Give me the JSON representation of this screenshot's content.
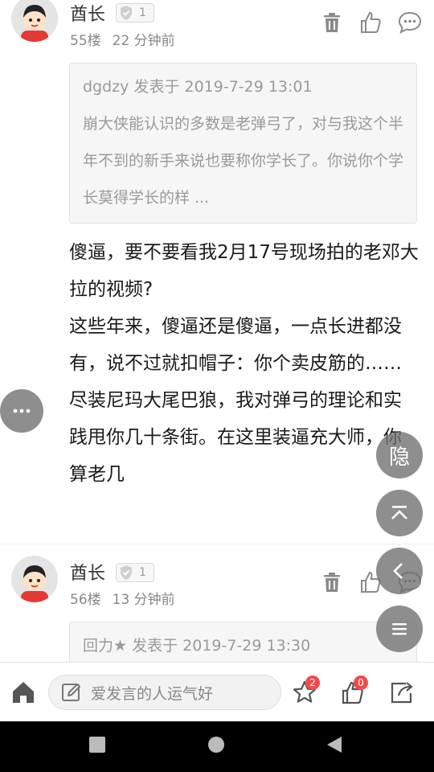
{
  "posts": [
    {
      "username": "酋长",
      "level": "1",
      "floor": "55楼",
      "time": "22 分钟前",
      "quote": {
        "header": "dgdzy 发表于 2019-7-29 13:01",
        "text": "崩大侠能认识的多数是老弹弓了，对与我这个半年不到的新手来说也要称你学长了。你说你个学长莫得学长的样 ..."
      },
      "content": [
        "傻逼，要不要看我2月17号现场拍的老邓大拉的视频?",
        "这些年来，傻逼还是傻逼，一点长进都没有，说不过就扣帽子：你个卖皮筋的……",
        "尽装尼玛大尾巴狼，我对弹弓的理论和实践甩你几十条街。在这里装逼充大师，你算老几"
      ]
    },
    {
      "username": "酋长",
      "level": "1",
      "floor": "56楼",
      "time": "13 分钟前",
      "quote": {
        "header": "回力★ 发表于 2019-7-29 13:30"
      }
    }
  ],
  "floating": {
    "hide_label": "隐"
  },
  "bottom_bar": {
    "comment_placeholder": "爱发言的人运气好",
    "favorite_count": "2",
    "like_count": "0"
  },
  "colors": {
    "badge": "#f24a4a",
    "fab": "#6e6e6e"
  }
}
